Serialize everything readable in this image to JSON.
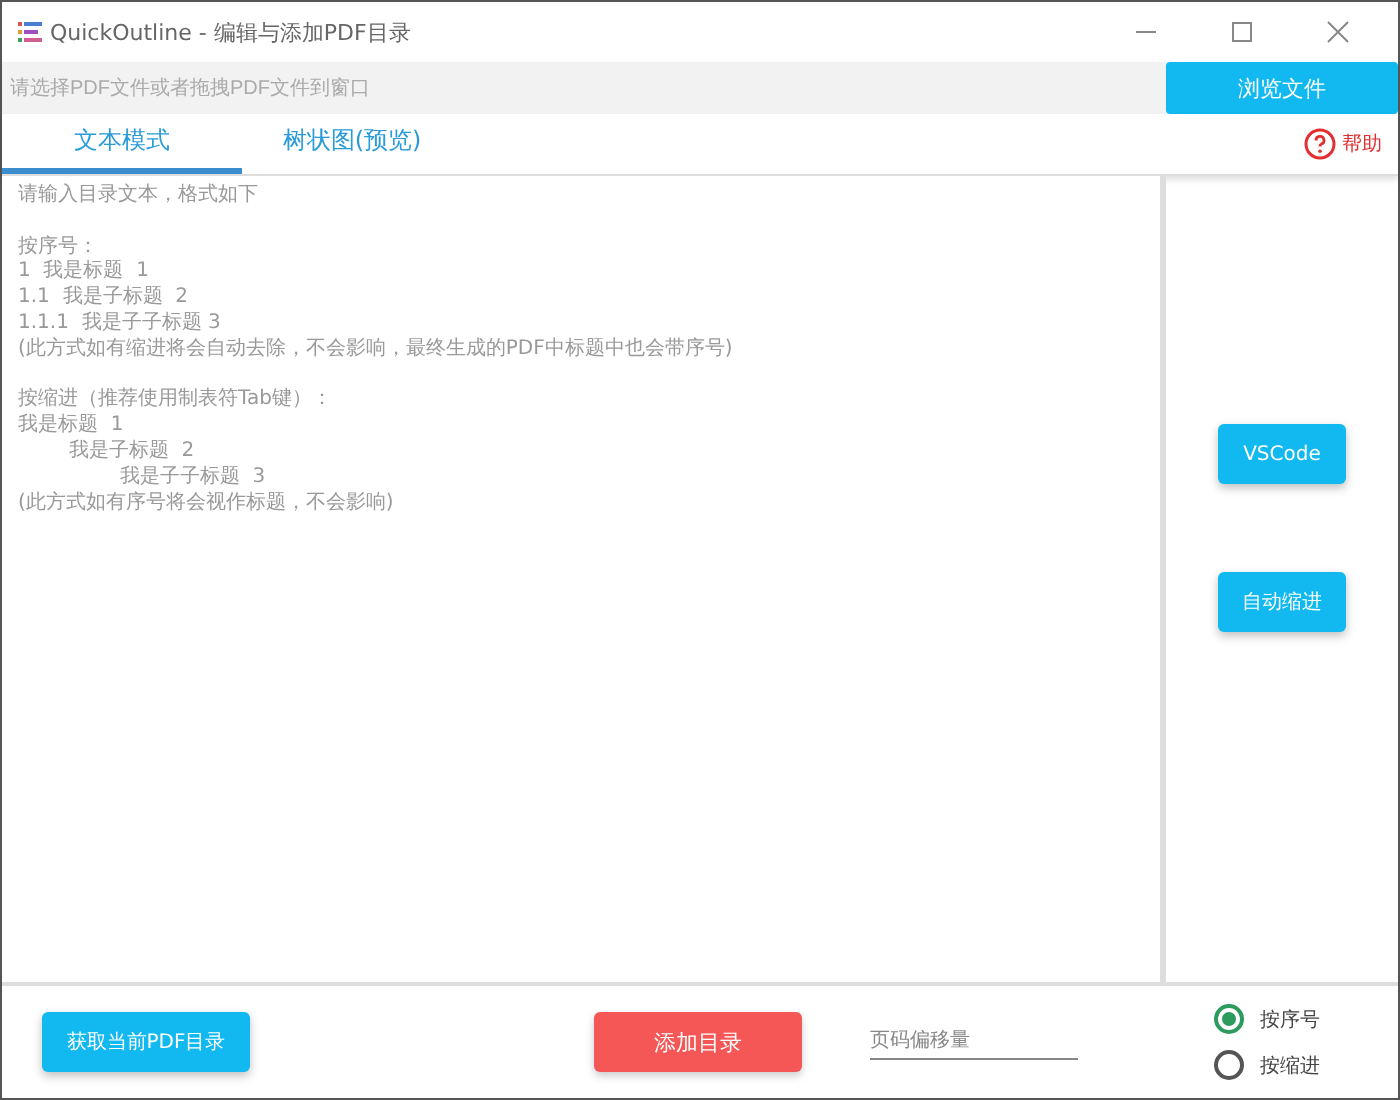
{
  "window": {
    "title": "QuickOutline - 编辑与添加PDF目录"
  },
  "file_bar": {
    "placeholder": "请选择PDF文件或者拖拽PDF文件到窗口",
    "browse_button": "浏览文件"
  },
  "tabs": [
    {
      "label": "文本模式",
      "selected": true
    },
    {
      "label": "树状图(预览)",
      "selected": false
    }
  ],
  "help": "帮助",
  "editor": {
    "blocks": [
      {
        "lines": [
          "请输入目录文本，格式如下"
        ]
      },
      {
        "lines": [
          "按序号：",
          "1  我是标题  1",
          "1.1  我是子标题  2",
          "1.1.1  我是子子标题 3",
          "(此方式如有缩进将会自动去除，不会影响，最终生成的PDF中标题中也会带序号)"
        ]
      },
      {
        "lines": [
          "按缩进（推荐使用制表符Tab键）：",
          "我是标题  1",
          "        我是子标题  2",
          "                我是子子标题  3",
          "(此方式如有序号将会视作标题，不会影响)"
        ]
      }
    ]
  },
  "side_buttons": [
    "VSCode",
    "自动缩进"
  ],
  "bottom": {
    "get_button": "获取当前PDF目录",
    "add_button": "添加目录",
    "offset_field": {
      "placeholder": "页码偏移量"
    },
    "modes": [
      {
        "label": "按序号",
        "selected": true
      },
      {
        "label": "按缩进",
        "selected": false
      }
    ]
  }
}
